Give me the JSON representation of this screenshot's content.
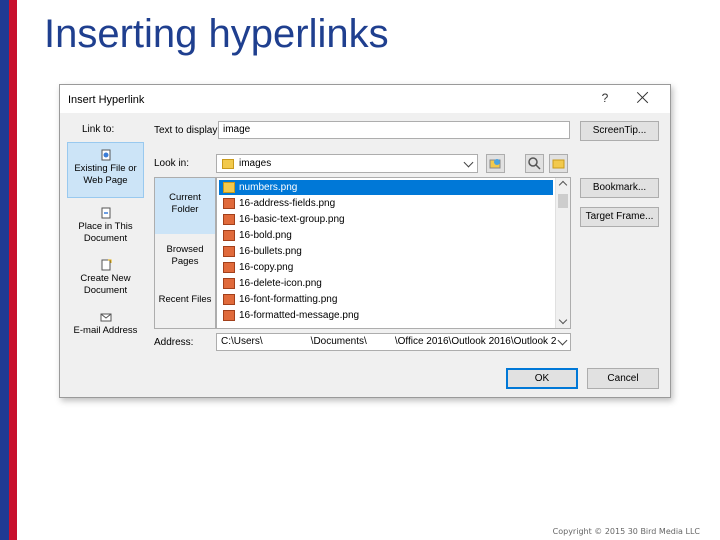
{
  "slide": {
    "title": "Inserting hyperlinks",
    "copyright": "Copyright © 2015 30 Bird Media LLC"
  },
  "dialog": {
    "title": "Insert Hyperlink",
    "help": "?",
    "link_to_label": "Link to:",
    "text_to_display_label": "Text to display:",
    "text_to_display_value": "image",
    "screentip_button": "ScreenTip...",
    "look_in_label": "Look in:",
    "look_in_value": "images",
    "bookmark_button": "Bookmark...",
    "target_frame_button": "Target Frame...",
    "address_label": "Address:",
    "address_parts": [
      "C:\\Users\\",
      "\\Documents\\",
      "\\Office 2016\\Outlook 2016\\Outlook 2"
    ],
    "ok_button": "OK",
    "cancel_button": "Cancel",
    "link_to_items": [
      {
        "line1": "Existing File or",
        "line2": "Web Page",
        "icon": "existing-file-icon"
      },
      {
        "line1": "Place in This",
        "line2": "Document",
        "icon": "place-in-document-icon"
      },
      {
        "line1": "Create New",
        "line2": "Document",
        "icon": "new-document-icon"
      },
      {
        "line1": "E-mail Address",
        "line2": "",
        "icon": "email-address-icon"
      }
    ],
    "places": [
      {
        "line1": "Current",
        "line2": "Folder"
      },
      {
        "line1": "Browsed",
        "line2": "Pages"
      },
      {
        "line1": "Recent Files",
        "line2": ""
      }
    ],
    "files": [
      {
        "name": "numbers.png",
        "type": "folder"
      },
      {
        "name": "16-address-fields.png",
        "type": "image"
      },
      {
        "name": "16-basic-text-group.png",
        "type": "image"
      },
      {
        "name": "16-bold.png",
        "type": "image"
      },
      {
        "name": "16-bullets.png",
        "type": "image"
      },
      {
        "name": "16-copy.png",
        "type": "image"
      },
      {
        "name": "16-delete-icon.png",
        "type": "image"
      },
      {
        "name": "16-font-formatting.png",
        "type": "image"
      },
      {
        "name": "16-formatted-message.png",
        "type": "image"
      }
    ]
  }
}
